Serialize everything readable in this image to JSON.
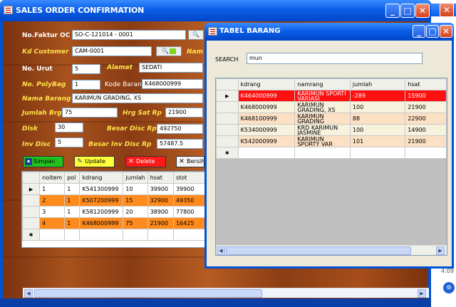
{
  "main_window": {
    "title": "SALES ORDER CONFIRMATION",
    "labels": {
      "no_faktur": "No.Faktur OC",
      "kd_customer": "Kd Customer",
      "nama_customer": "Nam",
      "no_urut": "No. Urut",
      "alamat": "Alamat",
      "no_polybag": "No. PolyBag",
      "kode_barang": "Kode Barang",
      "nama_barang": "Nama Barang",
      "jumlah_brg": "Jumlah Brg",
      "hrg_sat": "Hrg Sat  Rp",
      "disk": "Disk",
      "besar_disc": "Besar Disc  Rp",
      "inv_disc": "Inv Disc",
      "besar_inv_disc": "Besar Inv Disc  Rp"
    },
    "fields": {
      "no_faktur": "SO-C-121014 - 0001",
      "kd_customer": "CAM-0001",
      "no_urut": "5",
      "alamat": "SEDATI",
      "no_polybag": "1",
      "kode_barang": "K468000999",
      "nama_barang": "KARIMUN GRADING, XS",
      "jumlah_brg": "75",
      "hrg_sat": "21900",
      "disk": "30",
      "besar_disc": "492750",
      "inv_disc": "5",
      "besar_inv_disc": "57487.5"
    },
    "buttons": {
      "simpan": "Simpan",
      "update": "Update",
      "delete": "Delete",
      "bersihkan": "Bersih"
    },
    "grid": {
      "columns": [
        "noitem",
        "pol",
        "kdrang",
        "jumlah",
        "hsat",
        "stot"
      ],
      "rows": [
        [
          "1",
          "1",
          "K541300999",
          "10",
          "39900",
          "39900"
        ],
        [
          "2",
          "1",
          "K507200999",
          "15",
          "32900",
          "49350"
        ],
        [
          "3",
          "1",
          "K581200999",
          "20",
          "38900",
          "77800"
        ],
        [
          "4",
          "1",
          "K468000999",
          "75",
          "21900",
          "16425"
        ]
      ]
    }
  },
  "popup": {
    "title": "TABEL BARANG",
    "search_label": "SEARCH",
    "search_value": "mun",
    "grid": {
      "columns": [
        "kdrang",
        "namrang",
        "jumlah",
        "hsat"
      ],
      "rows": [
        [
          "K464000999",
          "KARIMUN SPORTI VARIASI",
          "-289",
          "15900"
        ],
        [
          "K468000999",
          "KARIMUN GRADING, XS",
          "100",
          "21900"
        ],
        [
          "K468100999",
          "KARIMUN GRADING",
          "88",
          "22900"
        ],
        [
          "K534000999",
          "KRD KARIMUN JASMINE",
          "100",
          "14900"
        ],
        [
          "K542000999",
          "KARIMUN SPORTY VAR",
          "101",
          "21900"
        ]
      ]
    }
  },
  "desktop": {
    "clock_partial": "4:09"
  },
  "colors": {
    "titlebar": "#0a5ee8",
    "wood": "#a8521c",
    "label_yellow": "#ffe24a",
    "row_orange": "#ff8a1d",
    "row_selected_red": "#ff1010"
  }
}
